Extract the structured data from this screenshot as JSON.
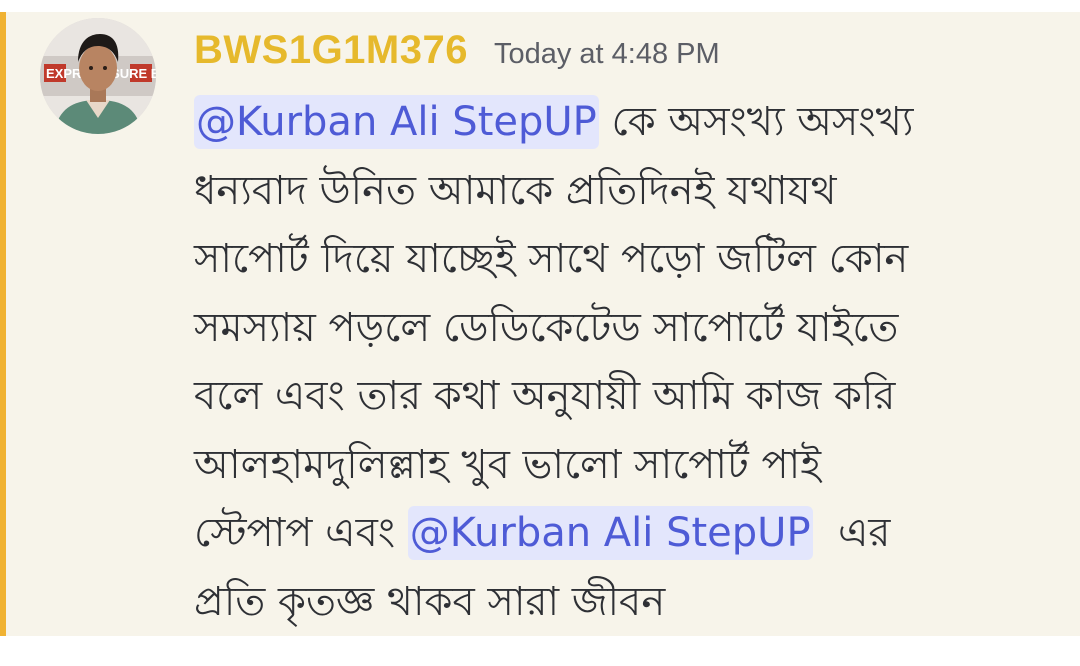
{
  "message": {
    "author": {
      "username": "BWS1G1M376",
      "avatar_icon": "user-avatar",
      "avatar_sign_text": "EXPRESS SURE BD"
    },
    "timestamp": "Today at 4:48 PM",
    "colors": {
      "username": "#e6b92c",
      "accent_bar": "#f0b232",
      "mention_bg": "#e3e6fc",
      "mention_text": "#4e5bd6",
      "message_bg": "#f7f4ea",
      "body_text": "#2e3035"
    },
    "lines": [
      {
        "mention": "@Kurban Ali StepUP",
        "text": " কে অসংখ্য অসংখ্য"
      },
      {
        "text": "ধন্যবাদ উনিত আমাকে প্রতিদিনই যথাযথ"
      },
      {
        "text": "সাপোর্ট দিয়ে যাচ্ছেই সাথে পড়ো জটিল কোন"
      },
      {
        "text": "সমস্যায় পড়লে ডেডিকেটেড সাপোর্টে যাইতে"
      },
      {
        "text": "বলে এবং তার কথা অনুযায়ী আমি কাজ করি"
      },
      {
        "text": "আলহামদুলিল্লাহ খুব ভালো সাপোর্ট পাই"
      },
      {
        "pre": "স্টেপাপ এবং ",
        "mention": "@Kurban Ali StepUP",
        "text": "  এর"
      },
      {
        "text": "প্রতি কৃতজ্ঞ থাকব সারা জীবন"
      }
    ]
  }
}
